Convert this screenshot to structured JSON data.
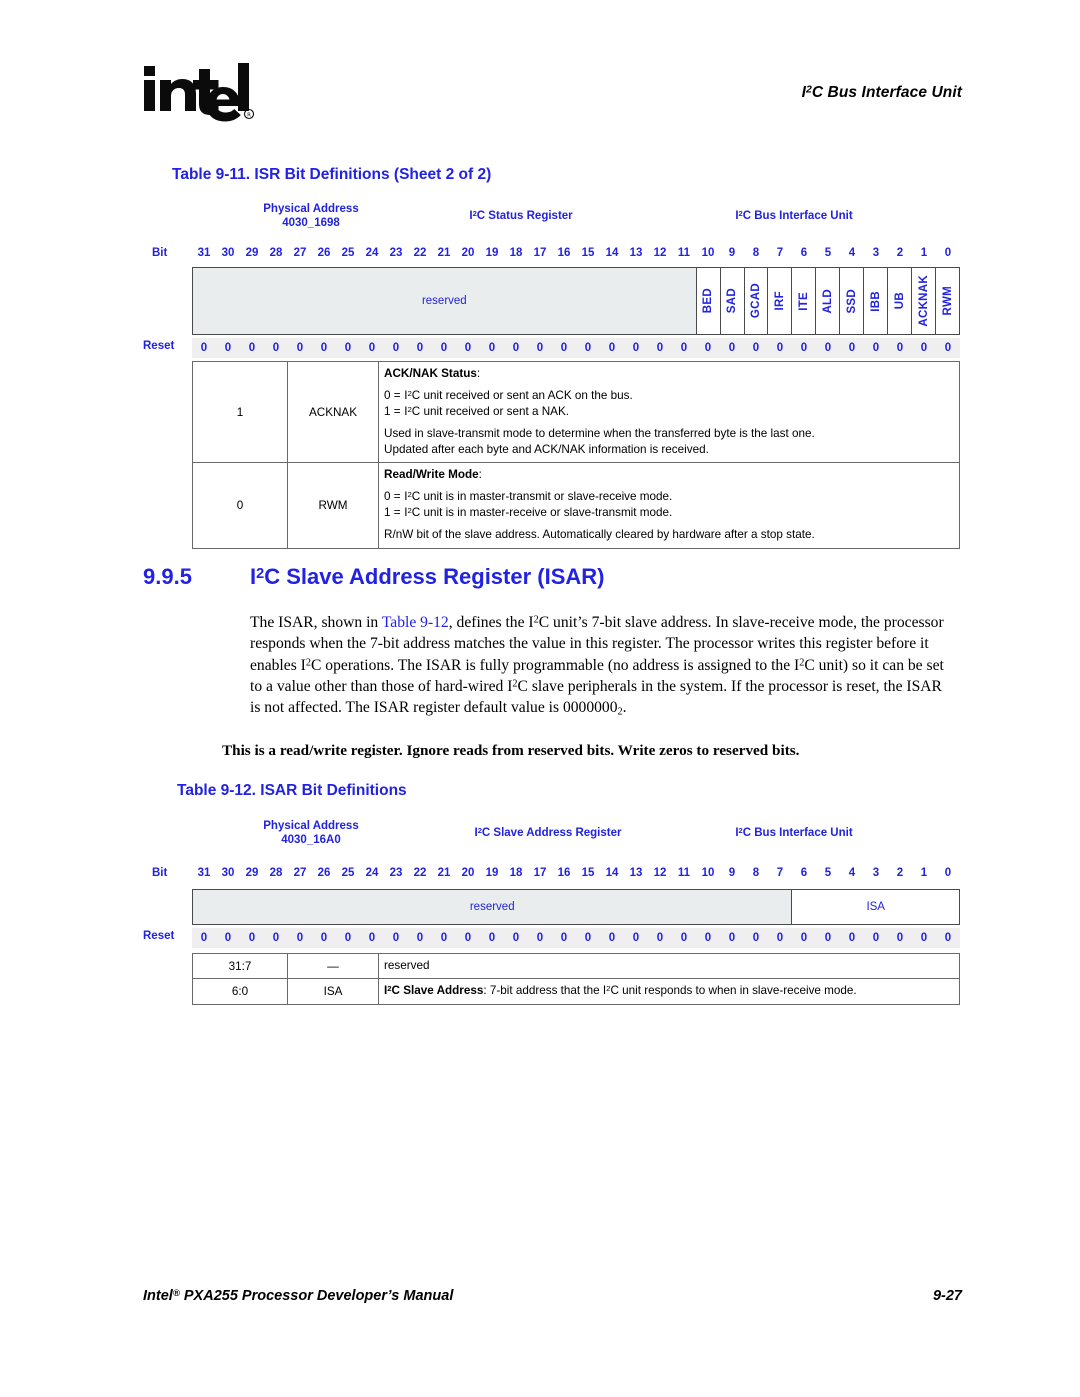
{
  "header": {
    "logo_alt": "intel",
    "title_pre": "I",
    "title_sup": "2",
    "title_post": "C Bus Interface Unit"
  },
  "table_9_11": {
    "caption": "Table 9-11.  ISR Bit Definitions (Sheet 2 of 2)",
    "labels": {
      "physical_address_title": "Physical Address",
      "physical_address_value": "4030_1698",
      "register_name_pre": "I",
      "register_name_sup": "2",
      "register_name_post": "C Status Register",
      "unit_pre": "I",
      "unit_sup": "2",
      "unit_post": "C Bus Interface Unit",
      "bit_label": "Bit",
      "reset_label": "Reset"
    },
    "bit_numbers": [
      "31",
      "30",
      "29",
      "28",
      "27",
      "26",
      "25",
      "24",
      "23",
      "22",
      "21",
      "20",
      "19",
      "18",
      "17",
      "16",
      "15",
      "14",
      "13",
      "12",
      "11",
      "10",
      "9",
      "8",
      "7",
      "6",
      "5",
      "4",
      "3",
      "2",
      "1",
      "0"
    ],
    "reserved_label": "reserved",
    "reserved_span": 21,
    "fields": [
      "BED",
      "SAD",
      "GCAD",
      "IRF",
      "ITE",
      "ALD",
      "SSD",
      "IBB",
      "UB",
      "ACKNAK",
      "RWM"
    ],
    "reset_values": [
      "0",
      "0",
      "0",
      "0",
      "0",
      "0",
      "0",
      "0",
      "0",
      "0",
      "0",
      "0",
      "0",
      "0",
      "0",
      "0",
      "0",
      "0",
      "0",
      "0",
      "0",
      "0",
      "0",
      "0",
      "0",
      "0",
      "0",
      "0",
      "0",
      "0",
      "0",
      "0"
    ],
    "rows": [
      {
        "bits": "1",
        "name": "ACKNAK",
        "desc_title": "ACK/NAK Status",
        "desc_title_colon": ":",
        "lines": [
          {
            "eq": "0 =",
            "pre": "I",
            "sup": "2",
            "post": "C unit received or sent an ACK on the bus."
          },
          {
            "eq": "1 =",
            "pre": "I",
            "sup": "2",
            "post": "C unit received or sent a NAK."
          }
        ],
        "paragraphs": [
          "Used in slave-transmit mode to determine when the transferred byte is the last one.",
          "Updated after each byte and ACK/NAK information is received."
        ]
      },
      {
        "bits": "0",
        "name": "RWM",
        "desc_title": "Read/Write Mode",
        "desc_title_colon": ":",
        "lines": [
          {
            "eq": "0 =",
            "pre": "I",
            "sup": "2",
            "post": "C unit is in master-transmit or slave-receive mode."
          },
          {
            "eq": "1 =",
            "pre": "I",
            "sup": "2",
            "post": "C unit is in master-receive or slave-transmit mode."
          }
        ],
        "paragraphs": [
          "R/nW bit of the slave address. Automatically cleared by hardware after a stop state."
        ]
      }
    ]
  },
  "section": {
    "number": "9.9.5",
    "title_pre": "I",
    "title_sup": "2",
    "title_post": "C Slave Address Register (ISAR)",
    "body": {
      "t1": "The ISAR, shown in ",
      "xref": "Table 9-12",
      "t2": ", defines the I",
      "sup1": "2",
      "t3": "C unit’s 7-bit slave address. In slave-receive mode, the processor responds when the 7-bit address matches the value in this register. The processor writes this register before it enables I",
      "sup2": "2",
      "t4": "C operations. The ISAR is fully programmable (no address is assigned to the I",
      "sup3": "2",
      "t5": "C unit) so it can be set to a value other than those of hard-wired I",
      "sup4": "2",
      "t6": "C slave peripherals in the system. If the processor is reset, the ISAR is not affected. The ISAR register default value is 0000000",
      "sub1": "2",
      "t7": "."
    },
    "note": "This is a read/write register. Ignore reads from reserved bits. Write zeros to reserved bits."
  },
  "table_9_12": {
    "caption": "Table 9-12.  ISAR Bit Definitions",
    "labels": {
      "physical_address_title": "Physical Address",
      "physical_address_value": "4030_16A0",
      "register_name_pre": "I",
      "register_name_sup": "2",
      "register_name_post": "C Slave Address Register",
      "unit_pre": "I",
      "unit_sup": "2",
      "unit_post": "C Bus Interface Unit",
      "bit_label": "Bit",
      "reset_label": "Reset"
    },
    "bit_numbers": [
      "31",
      "30",
      "29",
      "28",
      "27",
      "26",
      "25",
      "24",
      "23",
      "22",
      "21",
      "20",
      "19",
      "18",
      "17",
      "16",
      "15",
      "14",
      "13",
      "12",
      "11",
      "10",
      "9",
      "8",
      "7",
      "6",
      "5",
      "4",
      "3",
      "2",
      "1",
      "0"
    ],
    "reserved_label": "reserved",
    "reserved_span": 25,
    "isa_label": "ISA",
    "isa_span": 7,
    "reset_values": [
      "0",
      "0",
      "0",
      "0",
      "0",
      "0",
      "0",
      "0",
      "0",
      "0",
      "0",
      "0",
      "0",
      "0",
      "0",
      "0",
      "0",
      "0",
      "0",
      "0",
      "0",
      "0",
      "0",
      "0",
      "0",
      "0",
      "0",
      "0",
      "0",
      "0",
      "0",
      "0"
    ],
    "rows": [
      {
        "bits": "31:7",
        "name": "—",
        "desc_plain": "reserved"
      },
      {
        "bits": "6:0",
        "name": "ISA",
        "desc_title_pre": "I",
        "desc_title_sup": "2",
        "desc_title_post": "C Slave Address",
        "desc_title_colon": ":",
        "desc_rest_a": " 7-bit address that the I",
        "desc_rest_sup": "2",
        "desc_rest_b": "C unit responds to when in slave-receive mode."
      }
    ]
  },
  "footer": {
    "left_a": "Intel",
    "left_reg": "®",
    "left_b": " PXA255 Processor Developer’s Manual",
    "right": "9-27"
  },
  "colors": {
    "blue": "#2222E2",
    "reserved_fill": "#E9EDED",
    "reset_fill": "#EFEFEF",
    "border": "#4a4a4a"
  }
}
